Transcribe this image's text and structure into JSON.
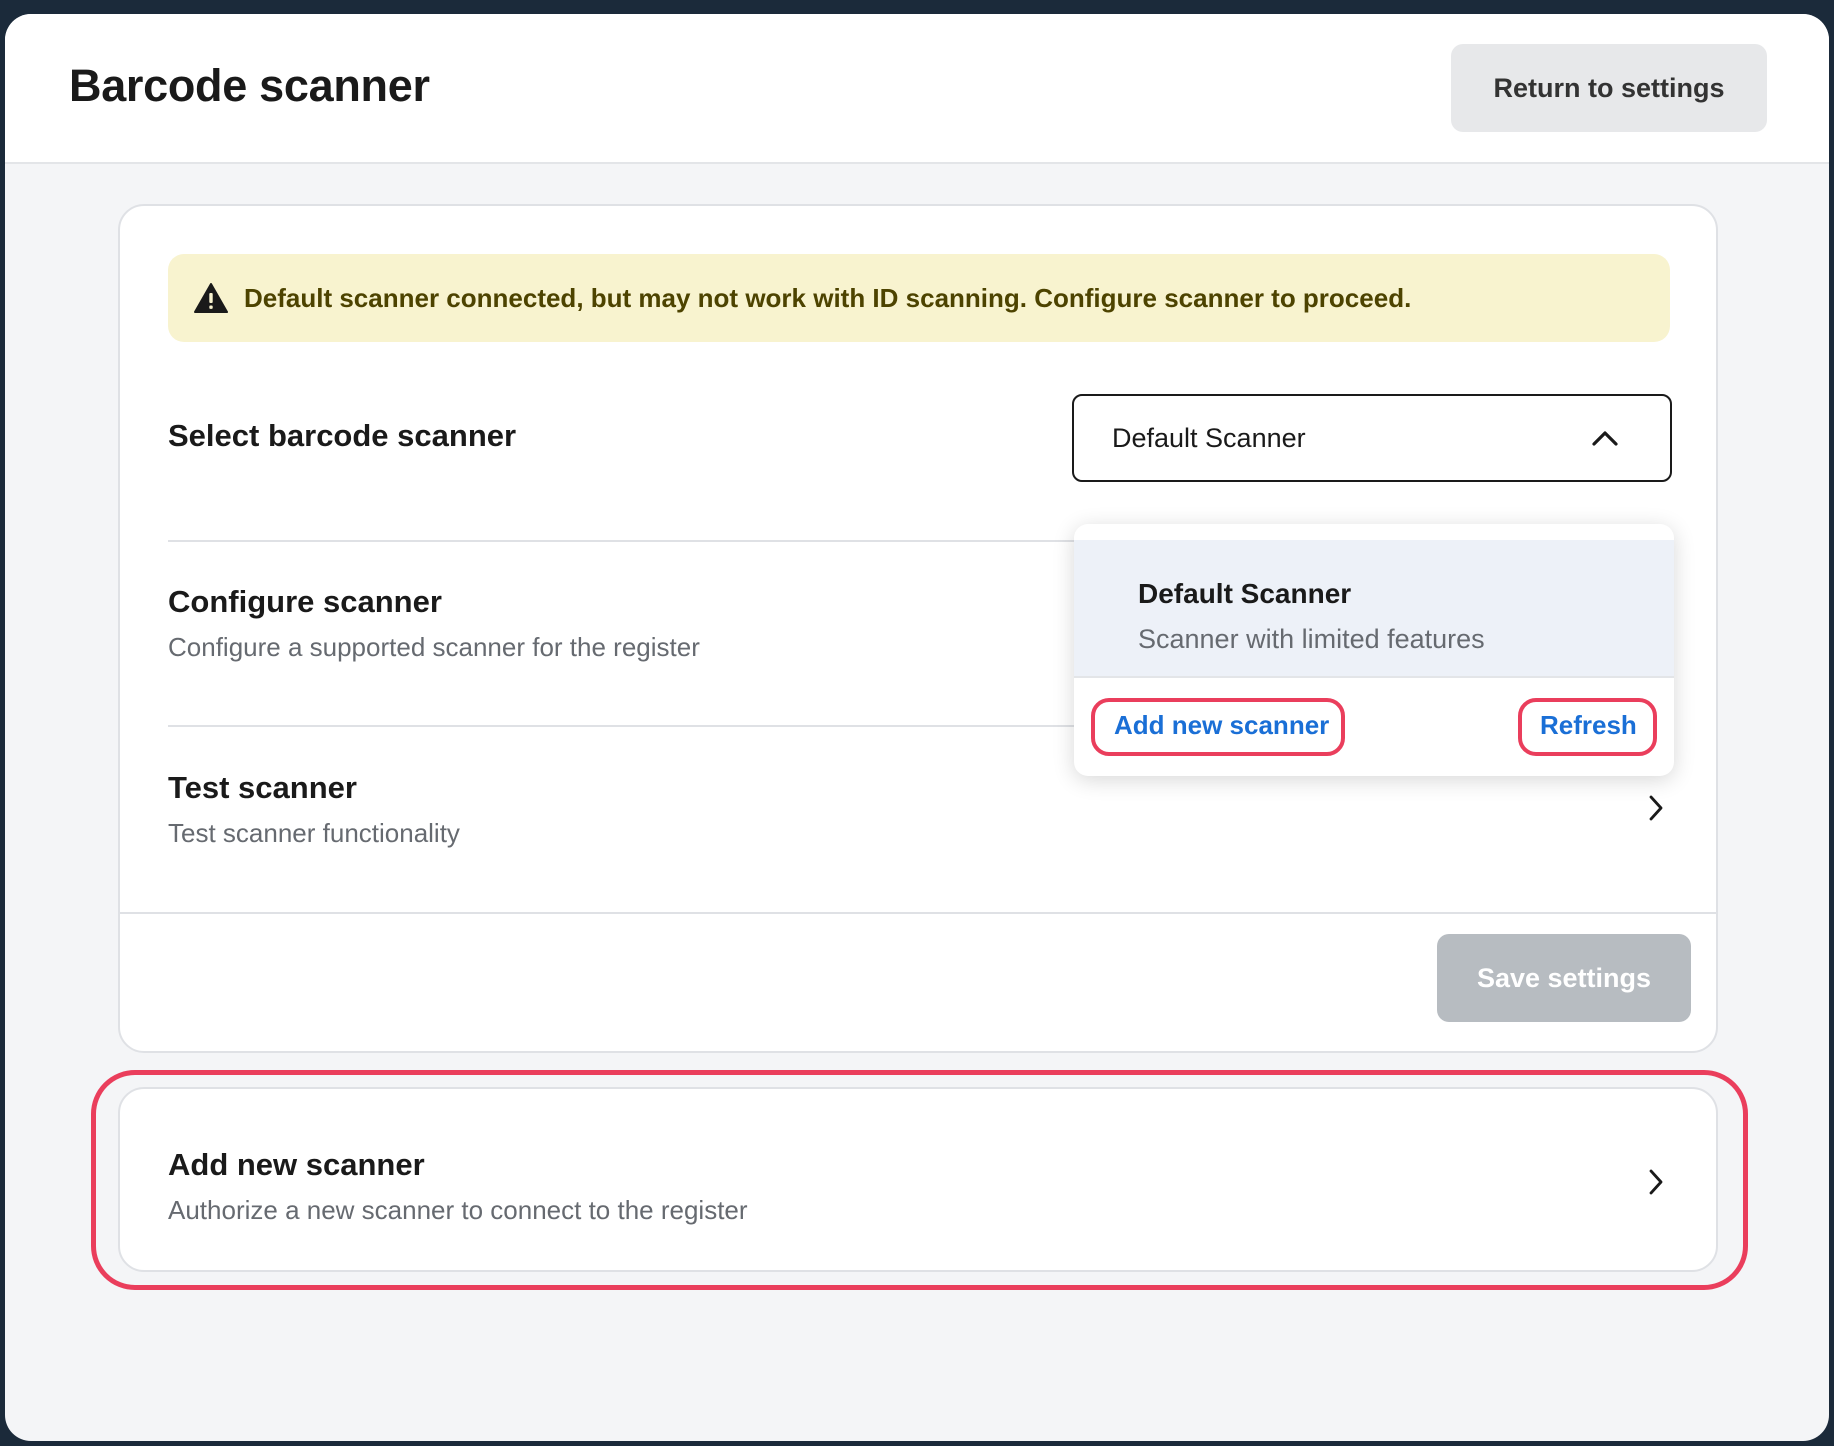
{
  "header": {
    "title": "Barcode scanner",
    "return_label": "Return to settings"
  },
  "warning": {
    "icon": "warning-triangle-icon",
    "text": "Default scanner connected, but may not work with ID scanning. Configure scanner to proceed.",
    "bg_color": "#f8f3cf",
    "text_color": "#4d4300"
  },
  "select_scanner": {
    "label": "Select barcode scanner",
    "value": "Default Scanner",
    "icon": "chevron-up-icon"
  },
  "dropdown": {
    "option_title": "Default Scanner",
    "option_subtitle": "Scanner with limited features",
    "add_new_label": "Add new scanner",
    "refresh_label": "Refresh",
    "link_color": "#1a6fd6"
  },
  "configure": {
    "title": "Configure scanner",
    "subtitle": "Configure a supported scanner for the register"
  },
  "test": {
    "title": "Test scanner",
    "subtitle": "Test scanner functionality"
  },
  "save_label": "Save settings",
  "add_card": {
    "title": "Add new scanner",
    "subtitle": "Authorize a new scanner to connect to the register"
  },
  "highlight_color": "#ea3e5c"
}
